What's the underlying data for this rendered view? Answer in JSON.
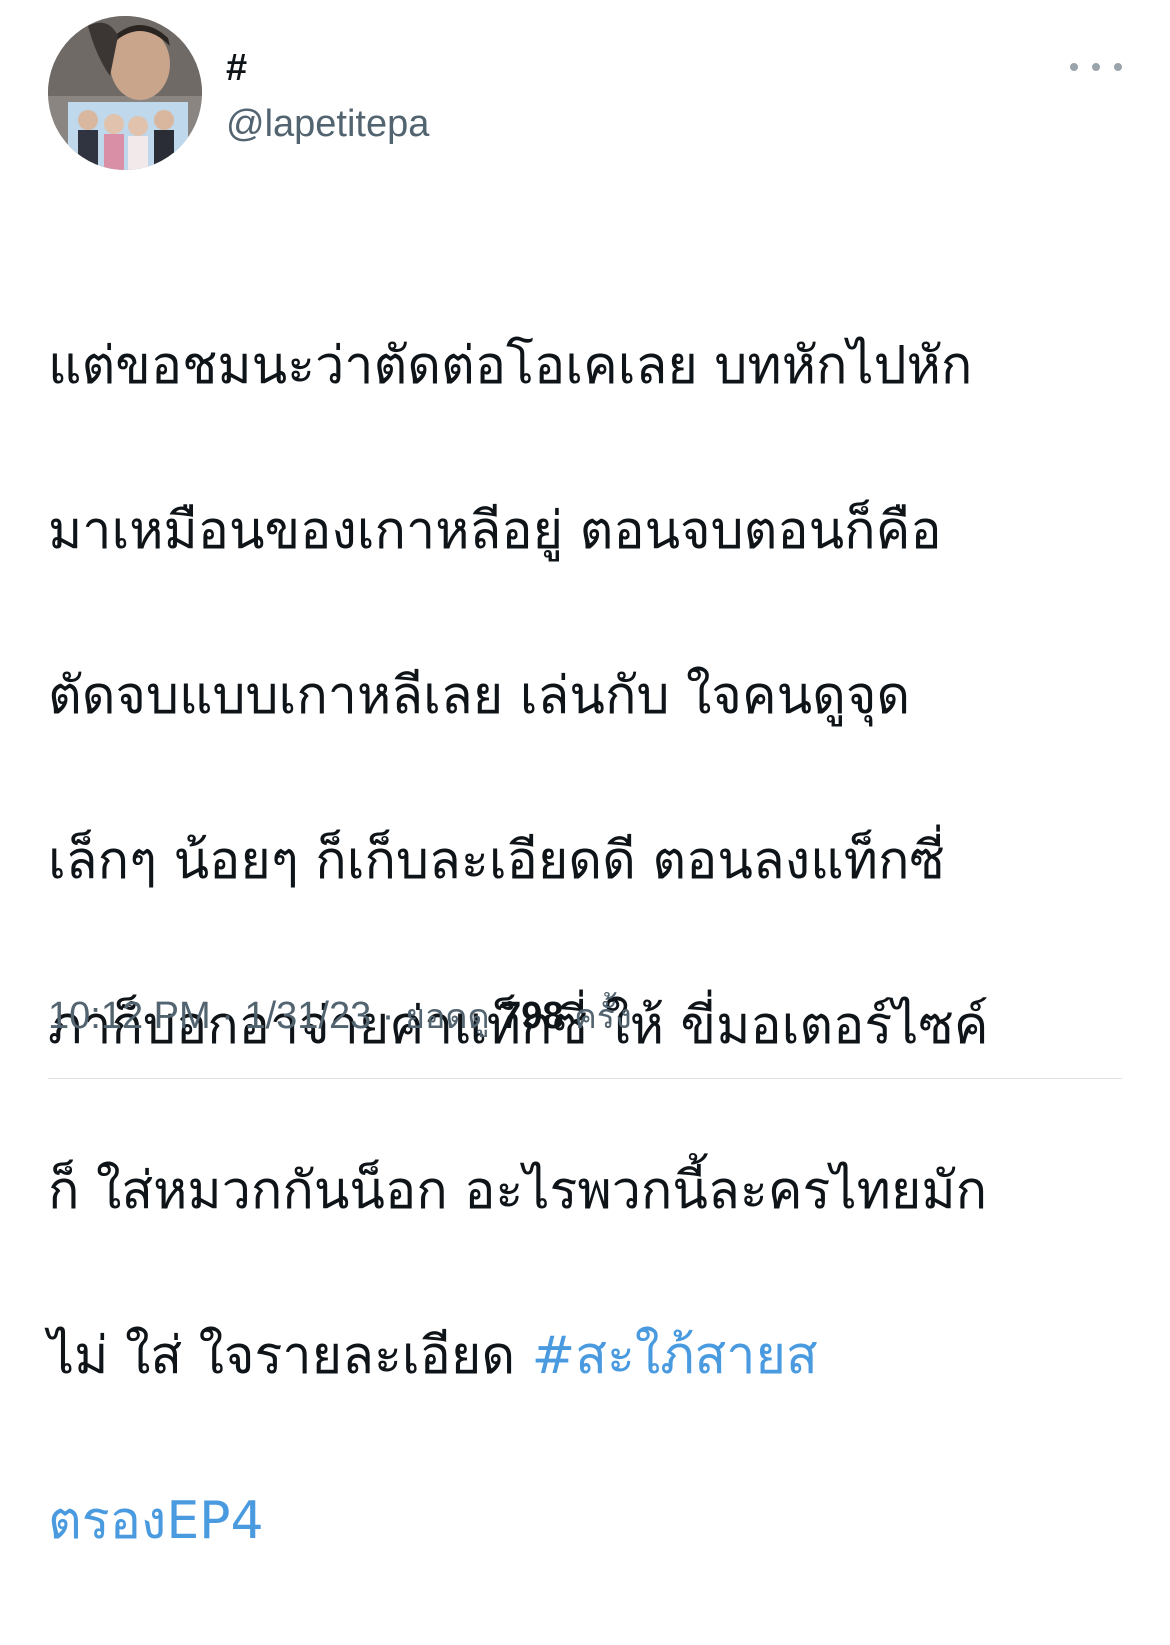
{
  "author": {
    "display_name": "#",
    "handle": "@lapetitepa",
    "avatar": "profile-photo"
  },
  "menu": {
    "icon": "more-horizontal-icon"
  },
  "tweet": {
    "lines": [
      "แต่ขอชมนะว่าตัดต่อโอเคเลย บทหักไปหัก",
      "มาเหมือนของเกาหลีอยู่ ตอนจบตอนก็คือ",
      "ตัดจบแบบเกาหลีเลย เล่นกับ ใจคนดูจุด",
      "เล็กๆ น้อยๆ ก็เก็บละเอียดดี ตอนลงแท็กซี่",
      "ภาก็บอกอาจ่ายค่าแท็กซี่ ให้ ขี่มอเตอร์ไซค์",
      "ก็ ใส่หมวกกันน็อก อะไรพวกนี้ละครไทยมัก",
      "ไม่ ใส่ ใจรายละเอียด "
    ],
    "hashtag_part1": "#สะใภ้สายส",
    "hashtag_part2": "ตรองEP4"
  },
  "meta": {
    "time": "10:12 PM",
    "separator": "·",
    "date": "1/31/23",
    "views_label": "ยอดดู",
    "views_count": "798",
    "views_unit": "ครั้ง"
  },
  "colors": {
    "text": "#0f1419",
    "secondary": "#536471",
    "hashtag": "#4a9ae0",
    "divider": "#dfe4e8"
  }
}
